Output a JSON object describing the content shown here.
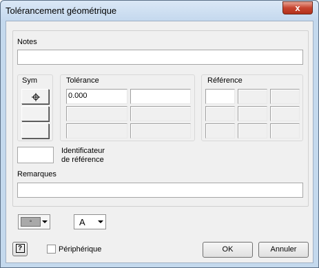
{
  "window": {
    "title": "Tolérancement géométrique",
    "close_glyph": "x"
  },
  "notes": {
    "label": "Notes",
    "value": ""
  },
  "sym": {
    "label": "Sym",
    "buttons": [
      "position-symbol-icon",
      "",
      ""
    ]
  },
  "tolerance": {
    "label": "Tolérance",
    "rows": [
      [
        "0.000",
        ""
      ],
      [
        "",
        ""
      ],
      [
        "",
        ""
      ]
    ]
  },
  "reference": {
    "label": "Référence"
  },
  "identifier": {
    "label_line1": "Identificateur",
    "label_line2": "de référence",
    "value": ""
  },
  "remarks": {
    "label": "Remarques",
    "value": ""
  },
  "tools": {
    "text_dropdown_value": "A",
    "marker_glyph": "◦"
  },
  "footer": {
    "help_glyph": "?",
    "peripheral_label": "Périphérique",
    "peripheral_checked": false,
    "ok_label": "OK",
    "cancel_label": "Annuler"
  }
}
